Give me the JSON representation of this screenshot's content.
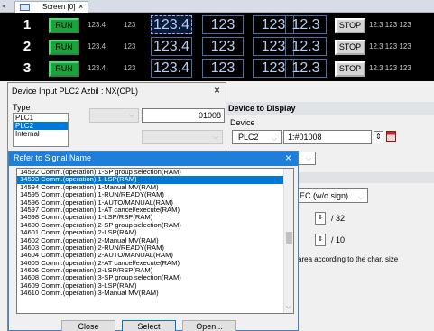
{
  "tab": {
    "label": "Screen [0]",
    "close": "×"
  },
  "screen": {
    "rows": [
      {
        "num": "1",
        "run": "RUN",
        "s1": "123.4",
        "s2": "123",
        "b1": "123.4",
        "b2": "123",
        "b3": "123",
        "b4": "12.3",
        "stop": "STOP",
        "tail": "12.3 123 123"
      },
      {
        "num": "2",
        "run": "RUN",
        "s1": "123.4",
        "s2": "123",
        "b1": "123.4",
        "b2": "123",
        "b3": "123",
        "b4": "12.3",
        "stop": "STOP",
        "tail": "12.3 123 123"
      },
      {
        "num": "3",
        "run": "RUN",
        "s1": "123.4",
        "s2": "123",
        "b1": "123.4",
        "b2": "123",
        "b3": "123",
        "b4": "12.3",
        "stop": "STOP",
        "tail": "12.3 123 123"
      }
    ]
  },
  "device_input": {
    "title": "Device Input  PLC2 Azbil : NX(CPL)",
    "close": "×",
    "type_label": "Type",
    "types": [
      "PLC1",
      "PLC2",
      "Internal"
    ],
    "address": "01008"
  },
  "display": {
    "section_title": "Device to Display",
    "device_label": "Device",
    "device": "PLC2",
    "address": "1:#01008",
    "format": "EC (w/o sign)",
    "spin1_suffix": "/ 32",
    "spin2_suffix": "/ 10",
    "info": "area according to the char. size"
  },
  "signal_dialog": {
    "title": "Refer to Signal Name",
    "close": "×",
    "items": [
      "14592  Comm.(operation) 1-SP group selection(RAM)",
      "14593  Comm.(operation) 1-LSP(RAM)",
      "14594  Comm.(operation) 1-Manual MV(RAM)",
      "14595  Comm.(operation) 1-RUN/READY(RAM)",
      "14596  Comm.(operation) 1-AUTO/MANUAL(RAM)",
      "14597  Comm.(operation) 1-AT cancel/execute(RAM)",
      "14598  Comm.(operation) 1-LSP/RSP(RAM)",
      "14600  Comm.(operation) 2-SP group selection(RAM)",
      "14601  Comm.(operation) 2-LSP(RAM)",
      "14602  Comm.(operation) 2-Manual MV(RAM)",
      "14603  Comm.(operation) 2-RUN/READY(RAM)",
      "14604  Comm.(operation) 2-AUTO/MANUAL(RAM)",
      "14605  Comm.(operation) 2-AT cancel/execute(RAM)",
      "14606  Comm.(operation) 2-LSP/RSP(RAM)",
      "14608  Comm.(operation) 3-SP group selection(RAM)",
      "14609  Comm.(operation) 3-LSP(RAM)",
      "14610  Comm.(operation) 3-Manual MV(RAM)"
    ],
    "selected_index": 1,
    "close_button": "Close",
    "select_button": "Select",
    "open_button": "Open..."
  }
}
